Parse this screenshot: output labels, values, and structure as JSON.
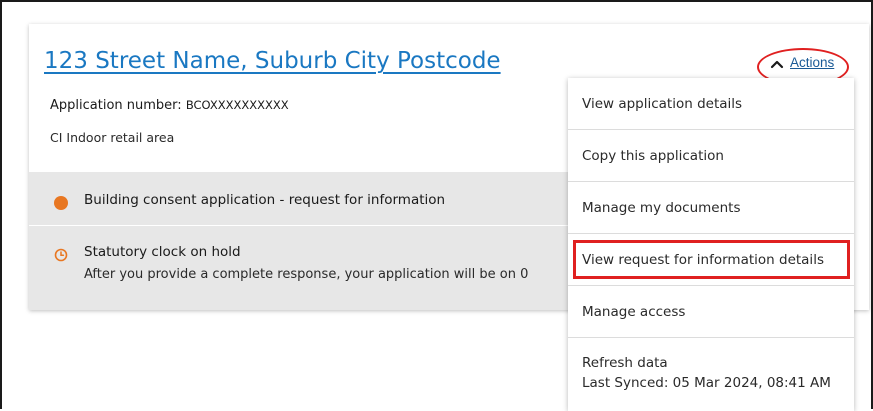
{
  "card": {
    "address": "123 Street Name, Suburb City Postcode",
    "application_label": "Application number:",
    "application_number": "BCOXXXXXXXXXX",
    "description": "CI Indoor retail area"
  },
  "status": {
    "dot_color": "#e87722",
    "title": "Building consent application - request for information",
    "hold_title": "Statutory clock on hold",
    "hold_body": "After you provide a complete response, your application will be on 0"
  },
  "actions": {
    "label": "Actions",
    "chevron_icon": "chevron-up-icon"
  },
  "menu": {
    "items": [
      {
        "label": "View application details"
      },
      {
        "label": "Copy this application"
      },
      {
        "label": "Manage my documents"
      },
      {
        "label": "View request for information details"
      },
      {
        "label": "Manage access"
      },
      {
        "label": "Refresh data",
        "sublabel": "Last Synced: 05 Mar 2024, 08:41 AM"
      }
    ]
  },
  "colors": {
    "link_blue": "#1a78c2",
    "annotation_red": "#e02020",
    "status_band": "#e7e7e7"
  }
}
